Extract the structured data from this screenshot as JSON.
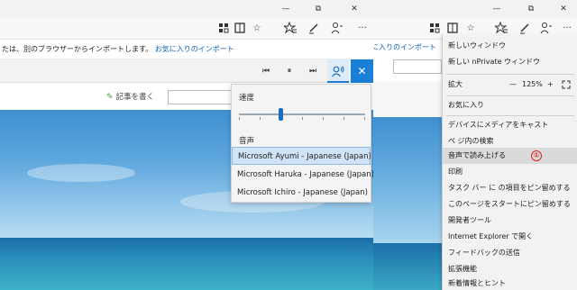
{
  "left": {
    "notice_text": "たは、別のブラウザーからインポートします。",
    "notice_link": "お気に入りのインポート",
    "write_button": "記事を書く",
    "dropdown": {
      "speed_label": "速度",
      "voice_label": "音声",
      "voices": [
        "Microsoft Ayumi - Japanese (Japan)",
        "Microsoft Haruka - Japanese (Japan)",
        "Microsoft Ichiro - Japanese (Japan)"
      ],
      "selected_voice_index": 0,
      "speed_level": 0.33
    }
  },
  "right": {
    "notice_link": "に入りのインポート",
    "menu": {
      "items": [
        "新しいウィンドウ",
        "新しい nPrivate ウィンドウ",
        "拡大",
        "お気に入り",
        "デバイスにメディアをキャスト",
        "ペ ジ内の検索",
        "音声で読み上げる",
        "印刷",
        "タスク バー に の項目をピン留めする",
        "このページをスタートにピン留めする",
        "開発者ツール",
        "Internet Explorer で開く",
        "フィードバックの送信",
        "拡張機能",
        "新着情報とヒント"
      ],
      "zoom_minus": "—",
      "zoom_value": "125%",
      "zoom_plus": "+",
      "highlight_badge": "①"
    }
  },
  "icons": {
    "minimize": "—",
    "maximize": "□",
    "restore": "⧉",
    "close": "✕",
    "more": "···",
    "star": "☆",
    "prev": "⏮",
    "pause": "⏸",
    "next": "⏭"
  },
  "colors": {
    "accent": "#1a7fd6",
    "arrow": "#e02020"
  }
}
